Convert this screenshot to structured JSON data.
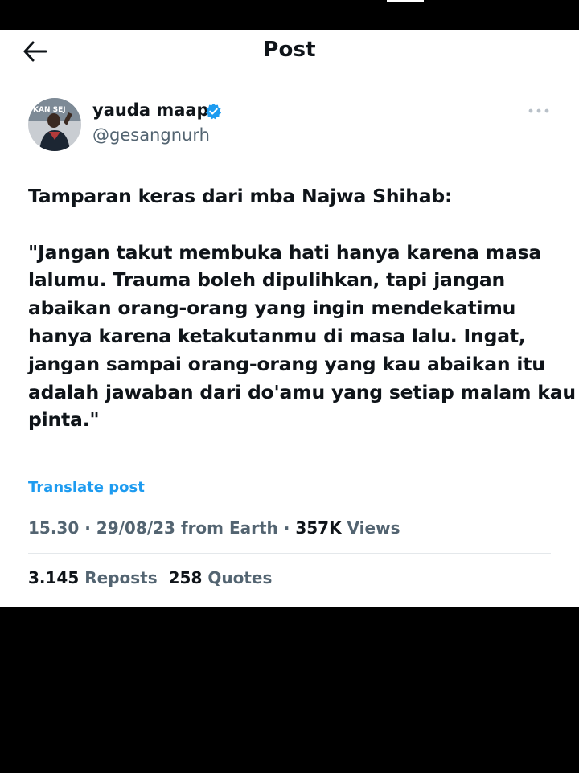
{
  "header": {
    "title": "Post",
    "back_icon": "arrow-left-icon"
  },
  "author": {
    "display_name": "yauda maap",
    "handle": "@gesangnurh",
    "verified_icon": "verified-badge-icon",
    "verified_color": "#1d9bf0",
    "avatar_text": "KAN SEJ"
  },
  "more_icon": "more-horizontal-icon",
  "tweet": {
    "lines": [
      "Tamparan keras dari mba Najwa Shihab:",
      "",
      "\"Jangan takut membuka hati hanya karena masa",
      "lalumu. Trauma boleh dipulihkan, tapi jangan",
      "abaikan orang-orang yang ingin mendekatimu",
      "hanya karena ketakutanmu di masa lalu. Ingat,",
      "jangan sampai orang-orang yang kau abaikan itu",
      "adalah jawaban dari do'amu yang setiap malam kau",
      "pinta.\""
    ]
  },
  "translate_label": "Translate post",
  "meta": {
    "time": "15.30",
    "sep1": " · ",
    "date": "29/08/23",
    "source": " from Earth",
    "sep2": " · ",
    "views_count": "357K",
    "views_label": " Views"
  },
  "stats": {
    "reposts_count": "3.145",
    "reposts_label": " Reposts",
    "quotes_count": "258",
    "quotes_label": " Quotes"
  },
  "colors": {
    "accent": "#1d9bf0",
    "text_primary": "#0f1419",
    "text_secondary": "#536471",
    "background": "#ffffff",
    "frame": "#000000"
  }
}
